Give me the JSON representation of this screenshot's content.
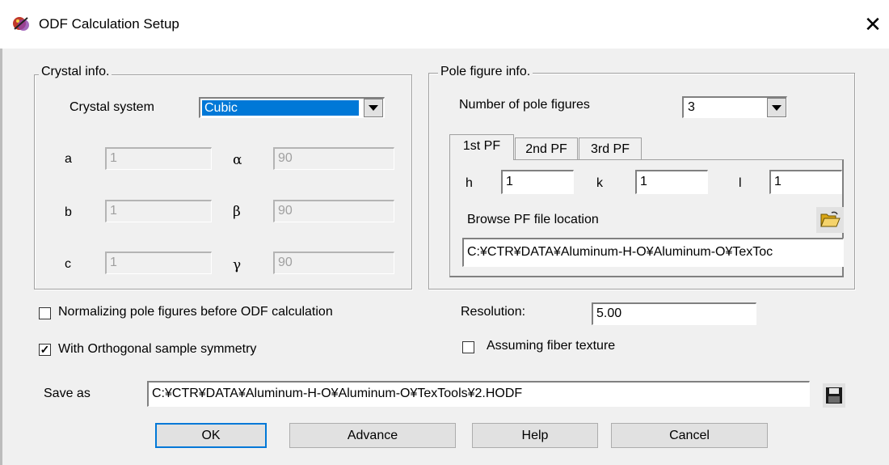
{
  "window": {
    "title": "ODF Calculation Setup",
    "close_symbol": "✕"
  },
  "crystal": {
    "legend": "Crystal info.",
    "system_label": "Crystal system",
    "system_value": "Cubic",
    "params": [
      {
        "label": "a",
        "value": "1"
      },
      {
        "label": "b",
        "value": "1"
      },
      {
        "label": "c",
        "value": "1"
      }
    ],
    "angles": [
      {
        "label": "α",
        "value": "90"
      },
      {
        "label": "β",
        "value": "90"
      },
      {
        "label": "γ",
        "value": "90"
      }
    ]
  },
  "pole": {
    "legend": "Pole figure info.",
    "count_label": "Number of pole figures",
    "count_value": "3",
    "tabs": [
      "1st PF",
      "2nd PF",
      "3rd PF"
    ],
    "h_label": "h",
    "h_value": "1",
    "k_label": "k",
    "k_value": "1",
    "l_label": "l",
    "l_value": "1",
    "browse_label": "Browse PF file location",
    "file_path": "C:¥CTR¥DATA¥Aluminum-H-O¥Aluminum-O¥TexToc"
  },
  "options": {
    "normalize_label": "Normalizing pole figures before ODF calculation",
    "normalize_checked": false,
    "orthogonal_label": "With Orthogonal sample symmetry",
    "orthogonal_checked": true,
    "resolution_label": "Resolution:",
    "resolution_value": "5.00",
    "fiber_label": "Assuming fiber texture",
    "fiber_checked": false
  },
  "save": {
    "label": "Save as",
    "path": "C:¥CTR¥DATA¥Aluminum-H-O¥Aluminum-O¥TexTools¥2.HODF"
  },
  "buttons": {
    "ok": "OK",
    "advance": "Advance",
    "help": "Help",
    "cancel": "Cancel"
  },
  "icons": {
    "open_folder": "folder-open-icon",
    "save_disk": "floppy-disk-icon",
    "app": "app-icon"
  },
  "colors": {
    "selection": "#0078d7",
    "folder": "#e8c35a",
    "disk": "#1a1a1a"
  }
}
